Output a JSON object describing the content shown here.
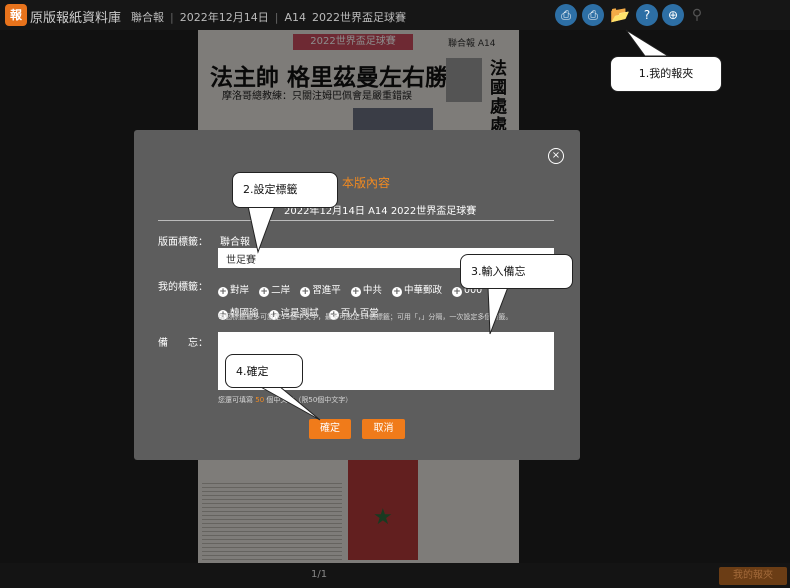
{
  "app": {
    "logo_glyph": "報",
    "title": "原版報紙資料庫"
  },
  "breadcrumb": {
    "paper": "聯合報",
    "date": "2022年12月14日",
    "page": "A14",
    "section": "2022世界盃足球賽",
    "separator": "|"
  },
  "toolbar": [
    {
      "name": "print-icon",
      "glyph": "⎙"
    },
    {
      "name": "print-page-icon",
      "glyph": "⎙"
    },
    {
      "name": "folder-icon",
      "glyph": "📂"
    },
    {
      "name": "help-icon",
      "glyph": "?"
    },
    {
      "name": "zoom-in-icon",
      "glyph": "⊕"
    },
    {
      "name": "search-icon",
      "glyph": "⚲"
    }
  ],
  "newspaper": {
    "banner": "2022世界盃足球賽",
    "page_id": "聯合報 A14",
    "headline": "法主帥 格里茲曼左右勝負",
    "subhead": "摩洛哥總教練：只關注姆巴佩會是嚴重錯誤",
    "side_headline": "法國處處占"
  },
  "modal": {
    "title": "本版內容",
    "subtitle": "2022年12月14日 A14 2022世界盃足球賽",
    "close_glyph": "×",
    "page_label_label": "版面標籤：",
    "page_label_value": "聯合報",
    "tag_input_value": "世足賽",
    "my_tags_label": "我的標籤：",
    "my_tags": [
      "對岸",
      "二岸",
      "習進平",
      "中共",
      "中華郵政",
      "000",
      "韓國瑜",
      "這是測試",
      "百人百堂"
    ],
    "tag_hint": "每個標籤最多可設定15個中文字，最多可設定10個標籤；可用「，」分隔，一次設定多個標籤。",
    "memo_label": "備　　忘：",
    "memo_value": "",
    "counter_prefix": "您還可填寫",
    "counter_value": "50",
    "counter_suffix": "個中文字（限50個中文字）",
    "confirm_label": "確定",
    "cancel_label": "取消"
  },
  "callouts": {
    "c1": "1.我的報夾",
    "c2": "2.設定標籤",
    "c3": "3.輸入備忘",
    "c4": "4.確定"
  },
  "bottom": {
    "page_indicator": "1/1",
    "folder_button": "我的報夾"
  }
}
